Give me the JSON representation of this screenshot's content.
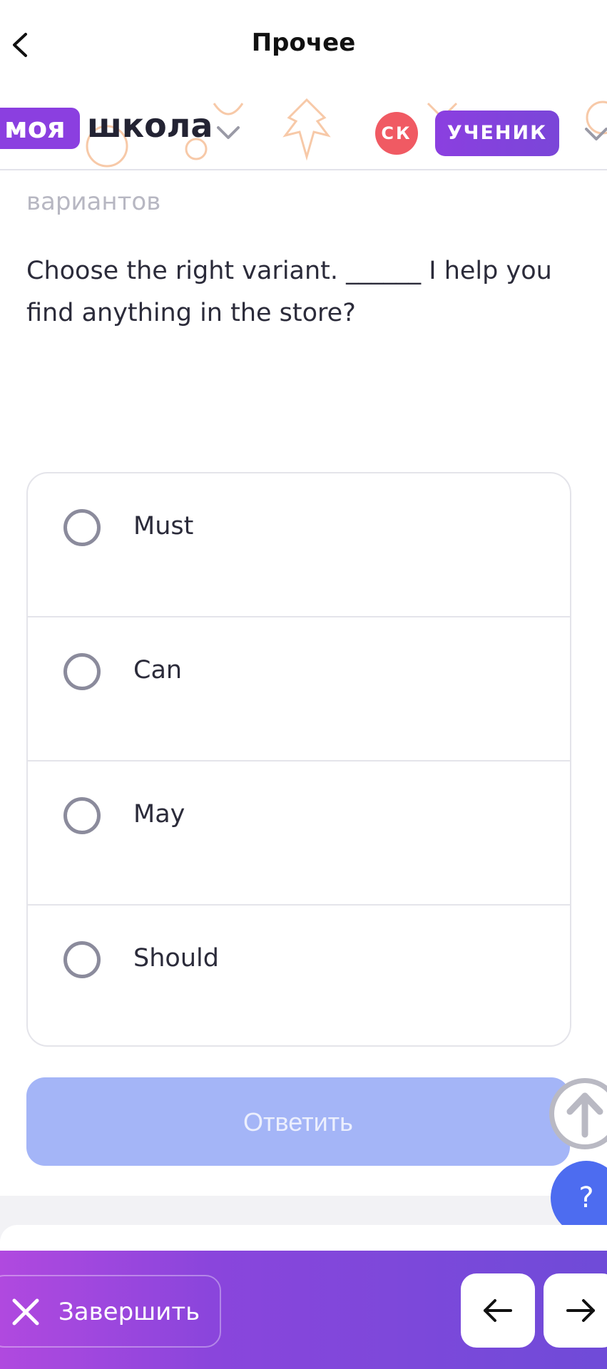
{
  "header": {
    "title": "Прочее",
    "back_icon": "chevron-left-icon"
  },
  "school": {
    "logo_part1": "моя",
    "logo_part2": "школа",
    "avatar_initials": "СК",
    "role": "УЧЕНИК"
  },
  "question": {
    "faded_text": "вариантов",
    "text": "Choose the right variant. ______ I help you find anything in the store?"
  },
  "options": [
    "Must",
    "Can",
    "May",
    "Should"
  ],
  "answer_button": "Ответить",
  "help_button": "?",
  "footer": {
    "finish_label": "Завершить",
    "prev_icon": "arrow-left-icon",
    "next_icon": "arrow-right-icon"
  },
  "colors": {
    "brand_purple": "#8b3fe0",
    "avatar_red": "#f05a63",
    "answer_disabled": "#a4b5f7",
    "help_blue": "#4d6cf0"
  }
}
